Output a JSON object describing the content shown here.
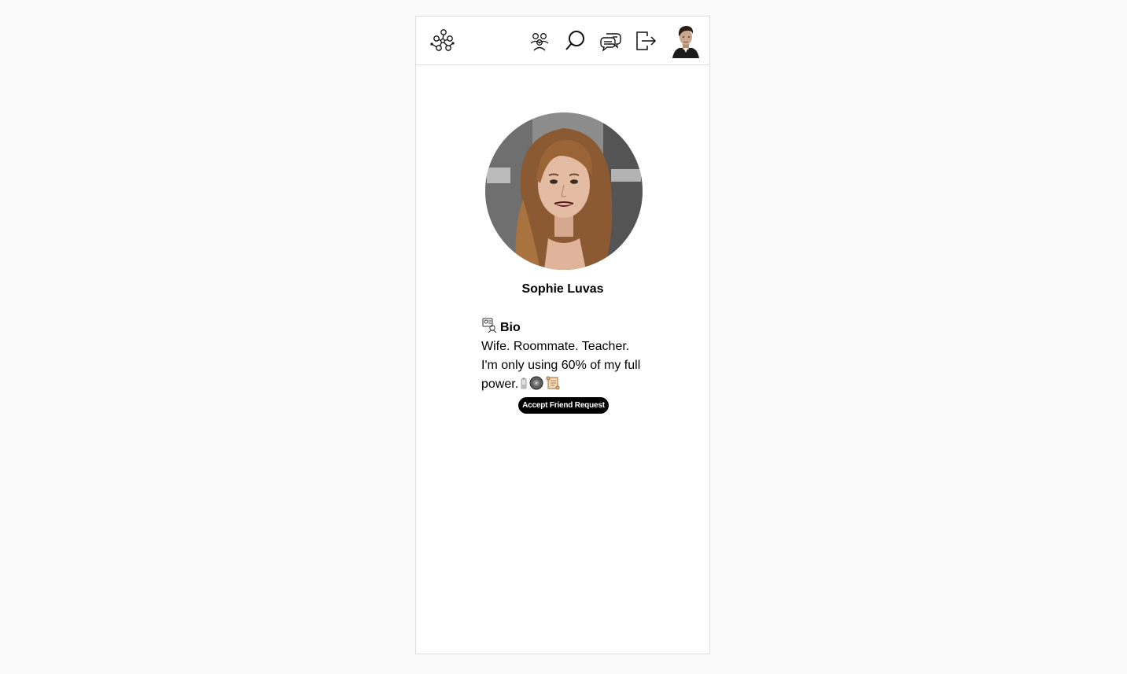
{
  "header": {
    "logo_icon": "network-people-icon",
    "nav": [
      {
        "icon": "friends-icon"
      },
      {
        "icon": "search-icon"
      },
      {
        "icon": "chat-icon"
      },
      {
        "icon": "logout-icon"
      }
    ],
    "avatar_icon": "user-avatar"
  },
  "profile": {
    "name": "Sophie Luvas",
    "bio": {
      "title": "Bio",
      "text": "Wife. Roommate. Teacher. I'm only using 60% of my full power."
    },
    "accept_button_label": "Accept Friend Request"
  }
}
